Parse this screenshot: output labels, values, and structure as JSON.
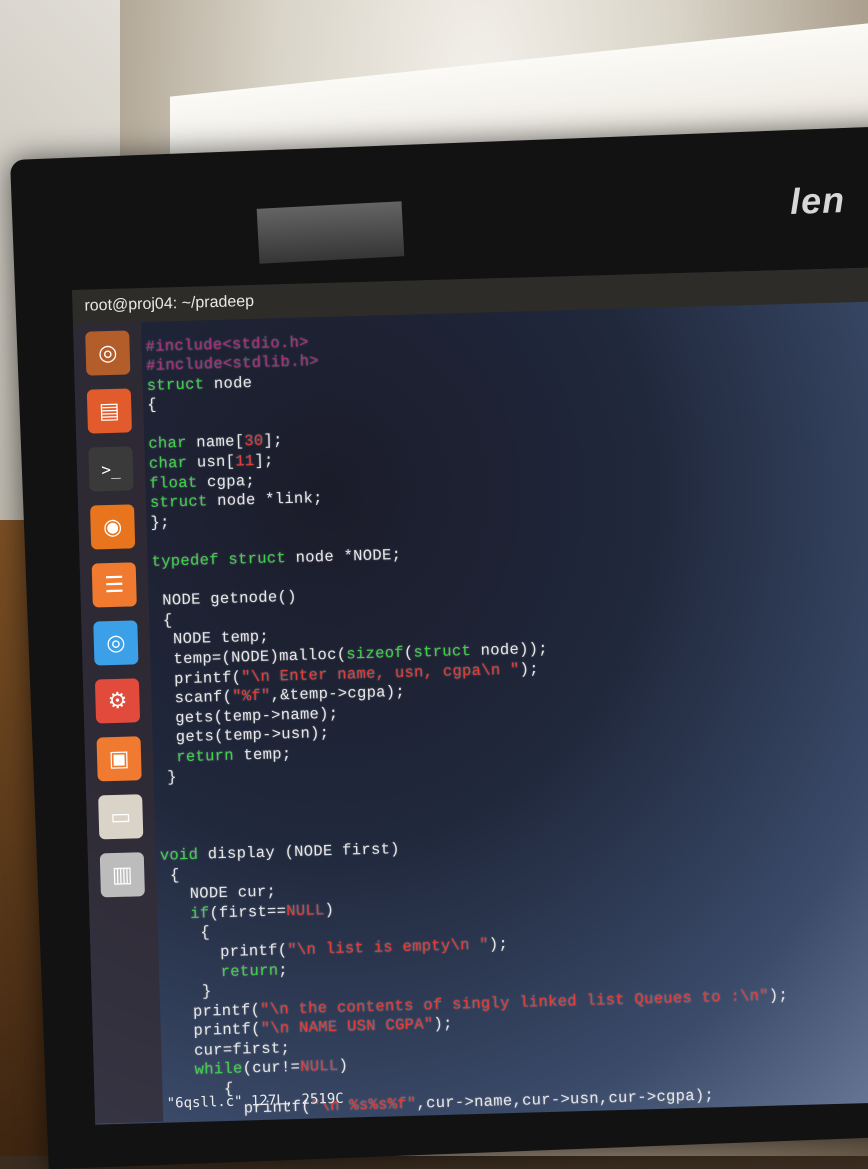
{
  "screen": {
    "title": "root@proj04: ~/pradeep",
    "brand": "len",
    "status_line": "\"6qsll.c\" 127L, 2519C"
  },
  "launcher": {
    "items": [
      {
        "name": "ubuntu-dash",
        "icon": "ubuntu-logo-icon",
        "color": "#b35d2a"
      },
      {
        "name": "files",
        "icon": "folder-icon",
        "color": "#e25b2c"
      },
      {
        "name": "terminal",
        "icon": "terminal-icon",
        "color": "#3a3a3a"
      },
      {
        "name": "firefox",
        "icon": "firefox-icon",
        "color": "#e8741d"
      },
      {
        "name": "text-editor",
        "icon": "document-icon",
        "color": "#f07a30"
      },
      {
        "name": "chromium",
        "icon": "chromium-icon",
        "color": "#3ba0e8"
      },
      {
        "name": "settings",
        "icon": "gear-icon",
        "color": "#e24b3b"
      },
      {
        "name": "software-center",
        "icon": "bag-icon",
        "color": "#f07a30"
      },
      {
        "name": "window",
        "icon": "window-icon",
        "color": "#d9d3c8"
      },
      {
        "name": "trash",
        "icon": "trash-icon",
        "color": "#bcbcbc"
      }
    ]
  },
  "code": [
    [
      {
        "t": "#include",
        "c": "inc"
      },
      {
        "t": "<stdio.h>",
        "c": "inc"
      }
    ],
    [
      {
        "t": "#include",
        "c": "inc"
      },
      {
        "t": "<stdlib.h>",
        "c": "inc"
      }
    ],
    [
      {
        "t": "struct",
        "c": "kw"
      },
      {
        "t": " node",
        "c": ""
      }
    ],
    [
      {
        "t": "{",
        "c": ""
      }
    ],
    [],
    [
      {
        "t": "char",
        "c": "kw"
      },
      {
        "t": " name[",
        "c": ""
      },
      {
        "t": "30",
        "c": "num"
      },
      {
        "t": "];",
        "c": ""
      }
    ],
    [
      {
        "t": "char",
        "c": "kw"
      },
      {
        "t": " usn[",
        "c": ""
      },
      {
        "t": "11",
        "c": "num"
      },
      {
        "t": "];",
        "c": ""
      }
    ],
    [
      {
        "t": "float",
        "c": "kw"
      },
      {
        "t": " cgpa;",
        "c": ""
      }
    ],
    [
      {
        "t": "struct",
        "c": "kw"
      },
      {
        "t": " node *link;",
        "c": ""
      }
    ],
    [
      {
        "t": "};",
        "c": ""
      }
    ],
    [],
    [
      {
        "t": "typedef",
        "c": "kw"
      },
      {
        "t": " ",
        "c": ""
      },
      {
        "t": "struct",
        "c": "kw"
      },
      {
        "t": " node *NODE;",
        "c": ""
      }
    ],
    [],
    [
      {
        "t": " NODE getnode()",
        "c": ""
      }
    ],
    [
      {
        "t": " {",
        "c": ""
      }
    ],
    [
      {
        "t": "  NODE temp;",
        "c": ""
      }
    ],
    [
      {
        "t": "  temp=(NODE)malloc(",
        "c": ""
      },
      {
        "t": "sizeof",
        "c": "kw"
      },
      {
        "t": "(",
        "c": ""
      },
      {
        "t": "struct",
        "c": "kw"
      },
      {
        "t": " node));",
        "c": ""
      }
    ],
    [
      {
        "t": "  printf(",
        "c": ""
      },
      {
        "t": "\"\\n Enter name, usn, cgpa\\n \"",
        "c": "str"
      },
      {
        "t": ");",
        "c": ""
      }
    ],
    [
      {
        "t": "  scanf(",
        "c": ""
      },
      {
        "t": "\"%f\"",
        "c": "str"
      },
      {
        "t": ",&temp->cgpa);",
        "c": ""
      }
    ],
    [
      {
        "t": "  gets(temp->name);",
        "c": ""
      }
    ],
    [
      {
        "t": "  gets(temp->usn);",
        "c": ""
      }
    ],
    [
      {
        "t": "  ",
        "c": ""
      },
      {
        "t": "return",
        "c": "kw"
      },
      {
        "t": " temp;",
        "c": ""
      }
    ],
    [
      {
        "t": " }",
        "c": ""
      }
    ],
    [],
    [],
    [],
    [
      {
        "t": "void",
        "c": "kw"
      },
      {
        "t": " display (NODE first)",
        "c": ""
      }
    ],
    [
      {
        "t": " {",
        "c": ""
      }
    ],
    [
      {
        "t": "   NODE cur;",
        "c": ""
      }
    ],
    [
      {
        "t": "   ",
        "c": ""
      },
      {
        "t": "if",
        "c": "kw"
      },
      {
        "t": "(first==",
        "c": ""
      },
      {
        "t": "NULL",
        "c": "str"
      },
      {
        "t": ")",
        "c": ""
      }
    ],
    [
      {
        "t": "    {",
        "c": ""
      }
    ],
    [
      {
        "t": "      printf(",
        "c": ""
      },
      {
        "t": "\"\\n list is empty\\n \"",
        "c": "str"
      },
      {
        "t": ");",
        "c": ""
      }
    ],
    [
      {
        "t": "      ",
        "c": ""
      },
      {
        "t": "return",
        "c": "kw"
      },
      {
        "t": ";",
        "c": ""
      }
    ],
    [
      {
        "t": "    }",
        "c": ""
      }
    ],
    [
      {
        "t": "   printf(",
        "c": ""
      },
      {
        "t": "\"\\n the contents of singly linked list Queues to :\\n\"",
        "c": "str"
      },
      {
        "t": ");",
        "c": ""
      }
    ],
    [
      {
        "t": "   printf(",
        "c": ""
      },
      {
        "t": "\"\\n NAME USN CGPA\"",
        "c": "str"
      },
      {
        "t": ");",
        "c": ""
      }
    ],
    [
      {
        "t": "   cur=first;",
        "c": ""
      }
    ],
    [
      {
        "t": "   ",
        "c": ""
      },
      {
        "t": "while",
        "c": "kw"
      },
      {
        "t": "(cur!=",
        "c": ""
      },
      {
        "t": "NULL",
        "c": "str"
      },
      {
        "t": ")",
        "c": ""
      }
    ],
    [
      {
        "t": "      {",
        "c": ""
      }
    ],
    [
      {
        "t": "        printf(",
        "c": ""
      },
      {
        "t": "\"\\n %s%s%f\"",
        "c": "str"
      },
      {
        "t": ",cur->name,cur->usn,cur->cgpa);",
        "c": ""
      }
    ]
  ]
}
